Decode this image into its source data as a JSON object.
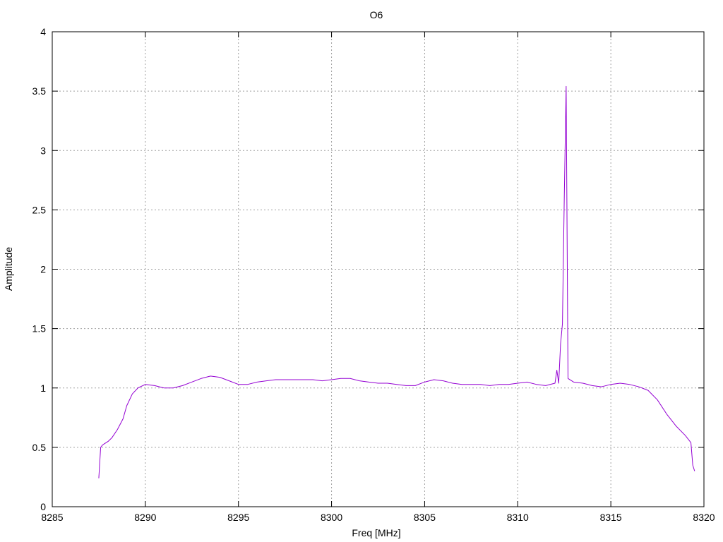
{
  "chart_data": {
    "type": "line",
    "title": "O6",
    "xlabel": "Freq [MHz]",
    "ylabel": "Amplitude",
    "xlim": [
      8285,
      8320
    ],
    "ylim": [
      0,
      4
    ],
    "x_ticks": [
      8285,
      8290,
      8295,
      8300,
      8305,
      8310,
      8315,
      8320
    ],
    "y_ticks": [
      0,
      0.5,
      1,
      1.5,
      2,
      2.5,
      3,
      3.5,
      4
    ],
    "y_tick_labels": [
      "0",
      "0.5",
      "1",
      "1.5",
      "2",
      "2.5",
      "3",
      "3.5",
      "4"
    ],
    "grid": true,
    "line_color": "#9400d3",
    "series": [
      {
        "x": [
          8287.5,
          8287.6,
          8287.7,
          8287.8,
          8288.0,
          8288.2,
          8288.5,
          8288.8,
          8289.0,
          8289.3,
          8289.6,
          8290.0,
          8290.5,
          8291.0,
          8291.5,
          8292.0,
          8292.5,
          8293.0,
          8293.5,
          8294.0,
          8294.5,
          8295.0,
          8295.5,
          8296.0,
          8296.5,
          8297.0,
          8297.5,
          8298.0,
          8298.5,
          8299.0,
          8299.5,
          8300.0,
          8300.5,
          8301.0,
          8301.5,
          8302.0,
          8302.5,
          8303.0,
          8303.5,
          8304.0,
          8304.5,
          8305.0,
          8305.5,
          8306.0,
          8306.5,
          8307.0,
          8307.5,
          8308.0,
          8308.5,
          8309.0,
          8309.5,
          8310.0,
          8310.5,
          8311.0,
          8311.5,
          8312.0,
          8312.1,
          8312.2,
          8312.3,
          8312.4,
          8312.5,
          8312.6,
          8312.7,
          8313.0,
          8313.5,
          8314.0,
          8314.5,
          8315.0,
          8315.5,
          8316.0,
          8316.5,
          8317.0,
          8317.5,
          8318.0,
          8318.5,
          8319.0,
          8319.2,
          8319.3,
          8319.4,
          8319.5
        ],
        "y": [
          0.24,
          0.5,
          0.52,
          0.53,
          0.55,
          0.58,
          0.65,
          0.74,
          0.85,
          0.95,
          1.0,
          1.03,
          1.02,
          1.0,
          1.0,
          1.02,
          1.05,
          1.08,
          1.1,
          1.09,
          1.06,
          1.03,
          1.03,
          1.05,
          1.06,
          1.07,
          1.07,
          1.07,
          1.07,
          1.07,
          1.06,
          1.07,
          1.08,
          1.08,
          1.06,
          1.05,
          1.04,
          1.04,
          1.03,
          1.02,
          1.02,
          1.05,
          1.07,
          1.06,
          1.04,
          1.03,
          1.03,
          1.03,
          1.02,
          1.03,
          1.03,
          1.04,
          1.05,
          1.03,
          1.02,
          1.04,
          1.15,
          1.04,
          1.37,
          1.54,
          2.61,
          3.54,
          1.08,
          1.05,
          1.04,
          1.02,
          1.01,
          1.03,
          1.04,
          1.03,
          1.01,
          0.98,
          0.9,
          0.78,
          0.68,
          0.6,
          0.56,
          0.54,
          0.35,
          0.3
        ]
      }
    ]
  }
}
